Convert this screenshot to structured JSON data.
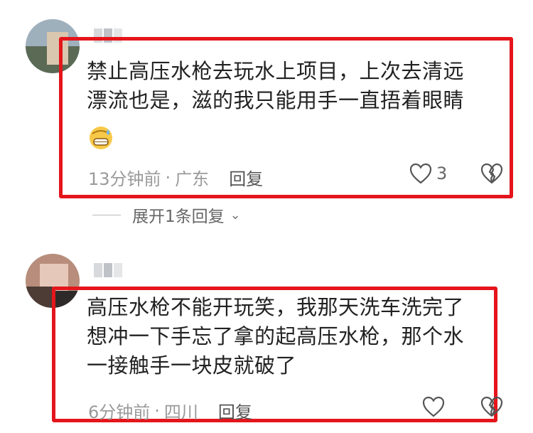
{
  "comments": [
    {
      "text_lines": [
        "禁止高压水枪去玩水上项目，上次去清远",
        "漂流也是，滋的我只能用手一直捂着眼睛"
      ],
      "emoji": "grimacing-sweat-emoji",
      "time": "13分钟前",
      "location": "广东",
      "separator": "·",
      "reply_label": "回复",
      "like_count": "3",
      "expand_replies": "展开1条回复"
    },
    {
      "text_lines": [
        "高压水枪不能开玩笑，我那天洗车洗完了",
        "想冲一下手忘了拿的起高压水枪，那个水",
        "一接触手一块皮就破了"
      ],
      "time": "6分钟前",
      "location": "四川",
      "separator": "·",
      "reply_label": "回复",
      "like_count": ""
    }
  ],
  "colors": {
    "highlight_box": "#e4151b",
    "meta_text": "#9a9a9a"
  }
}
